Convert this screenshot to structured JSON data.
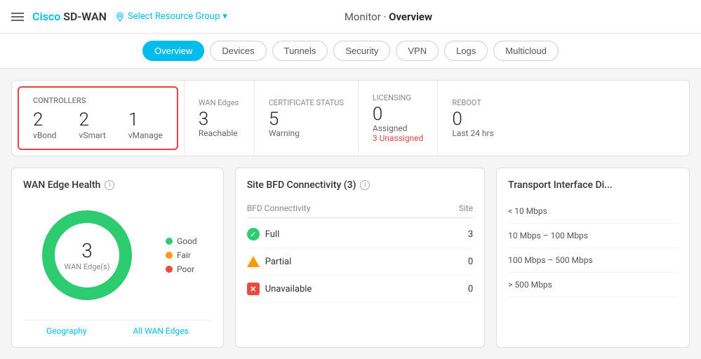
{
  "header": {
    "app_name": "Cisco SD-WAN",
    "cisco": "Cisco",
    "sdwan": " SD-WAN",
    "resource_group": "Select Resource Group",
    "monitor_label": "Monitor · ",
    "page_title": "Overview"
  },
  "nav": {
    "tabs": [
      {
        "label": "Overview",
        "active": true
      },
      {
        "label": "Devices",
        "active": false
      },
      {
        "label": "Tunnels",
        "active": false
      },
      {
        "label": "Security",
        "active": false
      },
      {
        "label": "VPN",
        "active": false
      },
      {
        "label": "Logs",
        "active": false
      },
      {
        "label": "Multicloud",
        "active": false
      }
    ]
  },
  "stats": {
    "controllers_label": "CONTROLLERS",
    "vbond_count": "2",
    "vbond_label": "vBond",
    "vsmart_count": "2",
    "vsmart_label": "vSmart",
    "vmanage_count": "1",
    "vmanage_label": "vManage",
    "wan_edges_label": "WAN Edges",
    "wan_edges_count": "3",
    "wan_edges_sub": "Reachable",
    "cert_status_label": "CERTIFICATE STATUS",
    "cert_status_count": "5",
    "cert_status_sub": "Warning",
    "licensing_label": "LICENSING",
    "licensing_count": "0",
    "licensing_sub": "Assigned",
    "licensing_unassigned": "3 Unassigned",
    "reboot_label": "REBOOT",
    "reboot_count": "0",
    "reboot_sub": "Last 24 hrs"
  },
  "wan_health": {
    "title": "WAN Edge Health",
    "donut_number": "3",
    "donut_label": "WAN Edge(s)",
    "legend": [
      {
        "label": "Good",
        "color": "#2ecc71"
      },
      {
        "label": "Fair",
        "color": "#f39c12"
      },
      {
        "label": "Poor",
        "color": "#e74c3c"
      }
    ],
    "footer_links": [
      "Geography",
      "All WAN Edges"
    ]
  },
  "bfd": {
    "title": "Site BFD Connectivity (3)",
    "col_connectivity": "BFD Connectivity",
    "col_site": "Site",
    "rows": [
      {
        "label": "Full",
        "count": "3",
        "type": "full"
      },
      {
        "label": "Partial",
        "count": "0",
        "type": "partial"
      },
      {
        "label": "Unavailable",
        "count": "0",
        "type": "unavailable"
      }
    ]
  },
  "transport": {
    "title": "Transport Interface Di...",
    "rows": [
      {
        "label": "< 10 Mbps"
      },
      {
        "label": "10 Mbps – 100 Mbps"
      },
      {
        "label": "100 Mbps – 500 Mbps"
      },
      {
        "label": "> 500 Mbps"
      }
    ]
  }
}
